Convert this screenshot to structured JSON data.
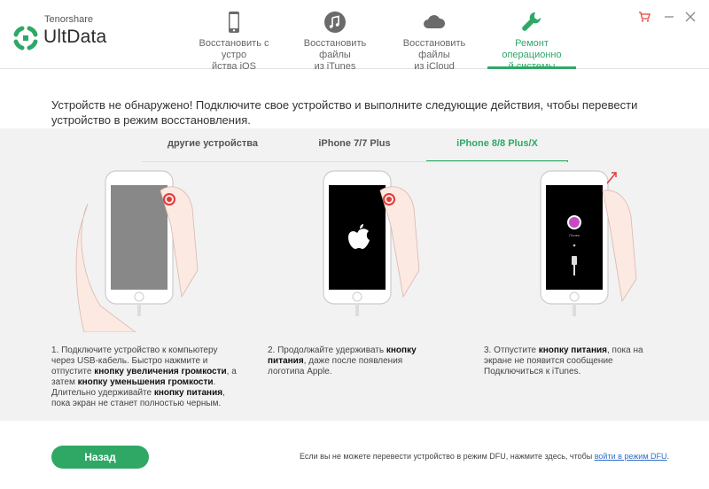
{
  "app": {
    "brand_small": "Tenorshare",
    "brand_big": "UltData",
    "accent_color": "#2fa866"
  },
  "nav": [
    {
      "label": "Восстановить с устро\nйства iOS",
      "icon": "phone-icon",
      "active": false
    },
    {
      "label": "Восстановить файлы\nиз iTunes",
      "icon": "music-icon",
      "active": false
    },
    {
      "label": "Восстановить файлы\nиз iCloud",
      "icon": "cloud-icon",
      "active": false
    },
    {
      "label": "Ремонт операционно\nй системы",
      "icon": "wrench-icon",
      "active": true
    }
  ],
  "window_controls": [
    "cart-icon",
    "minimize-icon",
    "close-icon"
  ],
  "instruction": "Устройств не обнаружено! Подключите свое устройство и выполните следующие действия, чтобы перевести устройство в режим восстановления.",
  "tabs": [
    {
      "label": "другие устройства",
      "active": false
    },
    {
      "label": "iPhone 7/7 Plus",
      "active": false
    },
    {
      "label": "iPhone 8/8 Plus/X",
      "active": true
    }
  ],
  "steps": {
    "s1": {
      "p1": "1. Подключите устройство к компьютеру через USB-кабель. Быстро нажмите и отпустите ",
      "b1": "кнопку увеличения громкости",
      "p2": ", а затем ",
      "b2": "кнопку уменьшения громкости",
      "p3": ". Длительно удерживайте ",
      "b3": "кнопку питания",
      "p4": ", пока экран не станет полностью черным."
    },
    "s2": {
      "p1": "2. Продолжайте удерживать ",
      "b1": "кнопку питания",
      "p2": ", даже после появления логотипа Apple."
    },
    "s3": {
      "p1": "3. Отпустите ",
      "b1": "кнопку питания",
      "p2": ", пока на экране не появится сообщение Подключиться к iTunes."
    }
  },
  "footer": {
    "back_label": "Назад",
    "dfu_text": "Если вы не можете перевести устройство в режим DFU, нажмите здесь, чтобы ",
    "dfu_link": "войти в режим DFU",
    "dfu_end": "."
  }
}
